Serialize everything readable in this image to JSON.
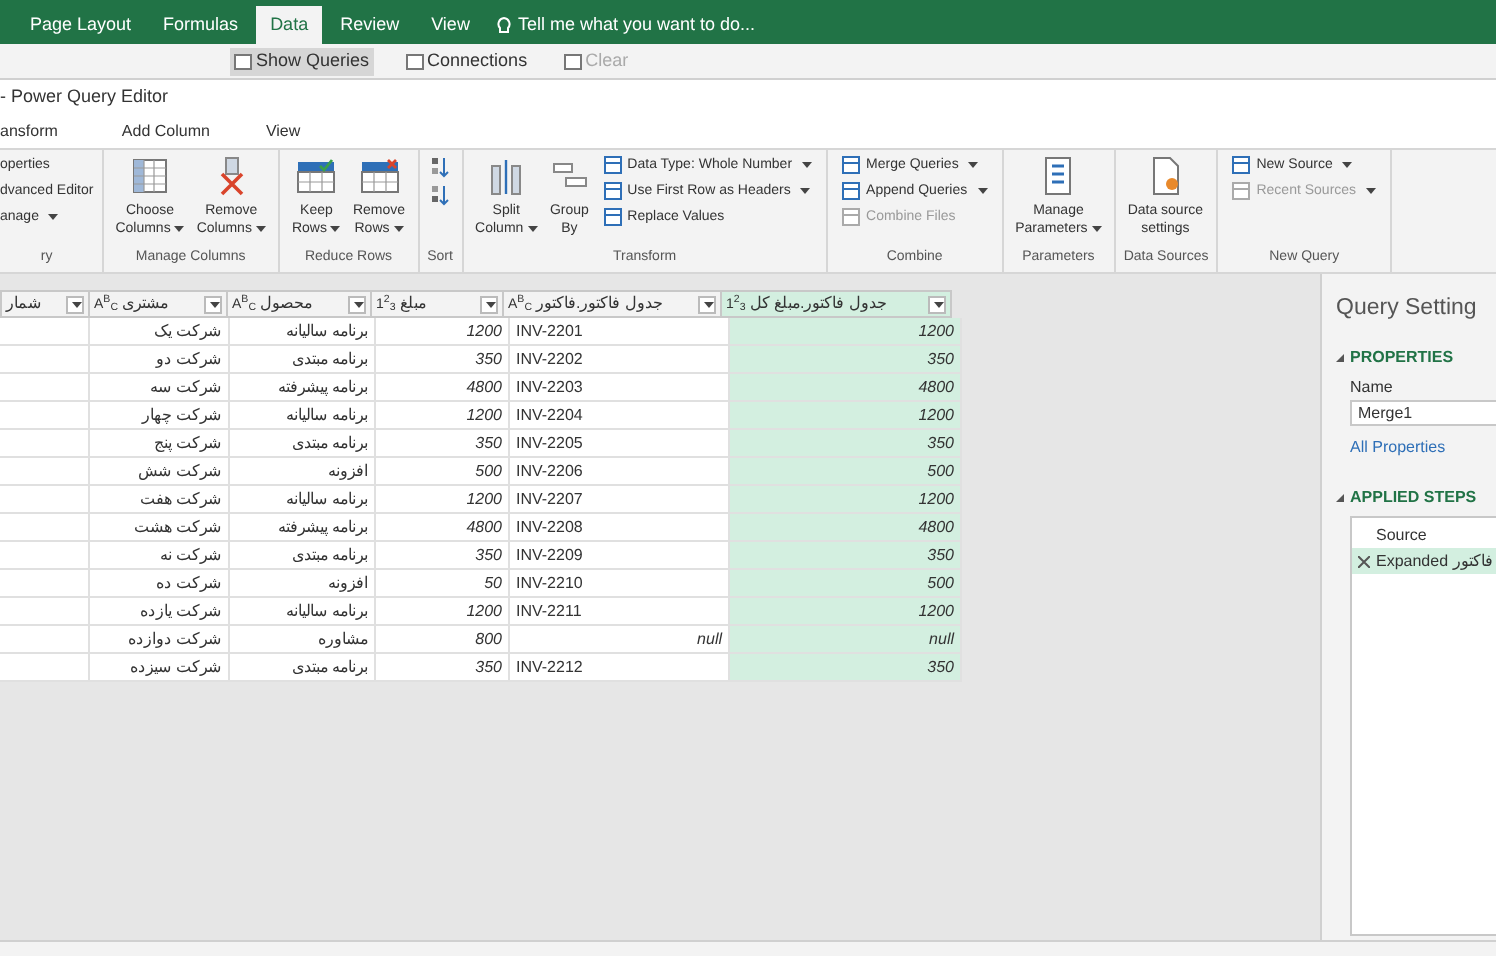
{
  "excel_tabs": [
    {
      "label": "Page Layout",
      "selected": false
    },
    {
      "label": "Formulas",
      "selected": false
    },
    {
      "label": "Data",
      "selected": true
    },
    {
      "label": "Review",
      "selected": false
    },
    {
      "label": "View",
      "selected": false
    }
  ],
  "tell_me": "Tell me what you want to do...",
  "excel_ribbon": [
    {
      "label": "Show Queries",
      "selected": true,
      "disabled": false
    },
    {
      "label": "Connections",
      "selected": false,
      "disabled": false
    },
    {
      "label": "Clear",
      "selected": false,
      "disabled": true
    }
  ],
  "window": {
    "title": "- Power Query Editor"
  },
  "tabs": [
    "ansform",
    "Add Column",
    "View"
  ],
  "ribbon_groups": [
    {
      "label": "ry",
      "items": [
        {
          "kind": "cut",
          "label": "operties",
          "dropdown": false,
          "disabled": false
        },
        {
          "kind": "cut",
          "label": "dvanced Editor",
          "dropdown": false,
          "disabled": false
        },
        {
          "kind": "cut",
          "label": "anage",
          "dropdown": true,
          "disabled": false
        }
      ]
    },
    {
      "label": "Manage Columns",
      "items": [
        {
          "kind": "large",
          "lines": [
            "Choose",
            "Columns"
          ],
          "dropdown": true
        },
        {
          "kind": "large",
          "lines": [
            "Remove",
            "Columns"
          ],
          "dropdown": true
        }
      ]
    },
    {
      "label": "Reduce Rows",
      "items": [
        {
          "kind": "large",
          "lines": [
            "Keep",
            "Rows"
          ],
          "dropdown": true
        },
        {
          "kind": "large",
          "lines": [
            "Remove",
            "Rows"
          ],
          "dropdown": true
        }
      ]
    },
    {
      "label": "Sort",
      "items": [
        {
          "kind": "sort"
        }
      ]
    },
    {
      "label": "Transform",
      "items": [
        {
          "kind": "large",
          "lines": [
            "Split",
            "Column"
          ],
          "dropdown": true
        },
        {
          "kind": "large",
          "lines": [
            "Group",
            "By"
          ],
          "dropdown": false
        },
        {
          "kind": "stack",
          "entries": [
            {
              "label": "Data Type: Whole Number",
              "dropdown": true,
              "disabled": false
            },
            {
              "label": "Use First Row as Headers",
              "dropdown": true,
              "disabled": false
            },
            {
              "label": "Replace Values",
              "dropdown": false,
              "disabled": false
            }
          ]
        }
      ]
    },
    {
      "label": "Combine",
      "items": [
        {
          "kind": "stack",
          "entries": [
            {
              "label": "Merge Queries",
              "dropdown": true,
              "disabled": false
            },
            {
              "label": "Append Queries",
              "dropdown": true,
              "disabled": false
            },
            {
              "label": "Combine Files",
              "dropdown": false,
              "disabled": true
            }
          ]
        }
      ]
    },
    {
      "label": "Parameters",
      "items": [
        {
          "kind": "large",
          "lines": [
            "Manage",
            "Parameters"
          ],
          "dropdown": true
        }
      ]
    },
    {
      "label": "Data Sources",
      "items": [
        {
          "kind": "large",
          "lines": [
            "Data source",
            "settings"
          ],
          "dropdown": false
        }
      ]
    },
    {
      "label": "New Query",
      "items": [
        {
          "kind": "stack",
          "entries": [
            {
              "label": "New Source",
              "dropdown": true,
              "disabled": false
            },
            {
              "label": "Recent Sources",
              "dropdown": true,
              "disabled": true
            }
          ]
        }
      ]
    }
  ],
  "table": {
    "columns": [
      {
        "label": "شمار",
        "selected": false
      },
      {
        "label": "مشتری",
        "type_icon": "A$^{B}$$_{C}$",
        "selected": false
      },
      {
        "label": "محصول",
        "type_icon": "A$^{B}$$_{C}$",
        "selected": false
      },
      {
        "label": "مبلغ",
        "type_icon": "1$^{2}$$_{3}$",
        "selected": false
      },
      {
        "label": "جدول فاکتور.فاکتور",
        "type_icon": "A$^{B}$$_{C}$",
        "selected": false
      },
      {
        "label": "جدول فاکتور.مبلغ کل",
        "type_icon": "1$^{2}$$_{3}$",
        "selected": true
      }
    ],
    "rows": [
      {
        "kind": "match",
        "cells": [
          "",
          "شرکت یک",
          "برنامه سالیانه",
          "1200",
          "INV-2201",
          "1200"
        ]
      },
      {
        "kind": "match",
        "cells": [
          "",
          "شرکت دو",
          "برنامه مبتدی",
          "350",
          "INV-2202",
          "350"
        ]
      },
      {
        "kind": "match",
        "cells": [
          "",
          "شرکت سه",
          "برنامه پیشرفته",
          "4800",
          "INV-2203",
          "4800"
        ]
      },
      {
        "kind": "match",
        "cells": [
          "",
          "شرکت چهار",
          "برنامه سالیانه",
          "1200",
          "INV-2204",
          "1200"
        ]
      },
      {
        "kind": "match",
        "cells": [
          "",
          "شرکت پنج",
          "برنامه مبتدی",
          "350",
          "INV-2205",
          "350"
        ]
      },
      {
        "kind": "match",
        "cells": [
          "",
          "شرکت شش",
          "افزونه",
          "500",
          "INV-2206",
          "500"
        ]
      },
      {
        "kind": "match",
        "cells": [
          "",
          "شرکت هفت",
          "برنامه سالیانه",
          "1200",
          "INV-2207",
          "1200"
        ]
      },
      {
        "kind": "match",
        "cells": [
          "",
          "شرکت هشت",
          "برنامه پیشرفته",
          "4800",
          "INV-2208",
          "4800"
        ]
      },
      {
        "kind": "match",
        "cells": [
          "",
          "شرکت نه",
          "برنامه مبتدی",
          "350",
          "INV-2209",
          "350"
        ]
      },
      {
        "kind": "match",
        "cells": [
          "",
          "شرکت ده",
          "افزونه",
          "50",
          "INV-2210",
          "500"
        ]
      },
      {
        "kind": "match",
        "cells": [
          "",
          "شرکت یازده",
          "برنامه سالیانه",
          "1200",
          "INV-2211",
          "1200"
        ]
      },
      {
        "kind": "no_match",
        "cells": [
          "",
          "شرکت دوازده",
          "مشاوره",
          "800",
          "null",
          "null"
        ]
      },
      {
        "kind": "match",
        "cells": [
          "",
          "شرکت سیزده",
          "برنامه مبتدی",
          "350",
          "INV-2212",
          "350"
        ]
      }
    ]
  },
  "query_settings": {
    "title": "Query Setting",
    "properties_heading": "PROPERTIES",
    "name_label": "Name",
    "name_value": "Merge1",
    "all_properties": "All Properties",
    "steps_heading": "APPLIED STEPS",
    "steps": [
      {
        "label": "Source",
        "selected": false
      },
      {
        "label": "Expanded فاکتور",
        "selected": true
      }
    ]
  }
}
